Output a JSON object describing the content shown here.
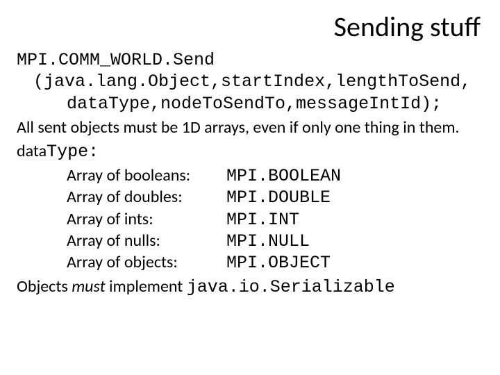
{
  "title": "Sending stuff",
  "code": {
    "line1": "MPI.COMM_WORLD.Send",
    "line2": "(java.lang.Object,startIndex,lengthToSend,",
    "line3": "dataType,nodeToSendTo,messageIntId);"
  },
  "note_arrays": "All sent objects must be 1D arrays, even if only one thing in them.",
  "datatype_label": "dataType:",
  "types": [
    {
      "label": "Array of booleans:",
      "value": "MPI.BOOLEAN"
    },
    {
      "label": "Array of doubles:",
      "value": "MPI.DOUBLE"
    },
    {
      "label": "Array of ints:",
      "value": "MPI.INT"
    },
    {
      "label": "Array of nulls:",
      "value": "MPI.NULL"
    },
    {
      "label": "Array of objects:",
      "value": "MPI.OBJECT"
    }
  ],
  "serializable": {
    "prefix": "Objects ",
    "must": "must",
    "mid": " implement ",
    "class": "java.io.Serializable"
  }
}
